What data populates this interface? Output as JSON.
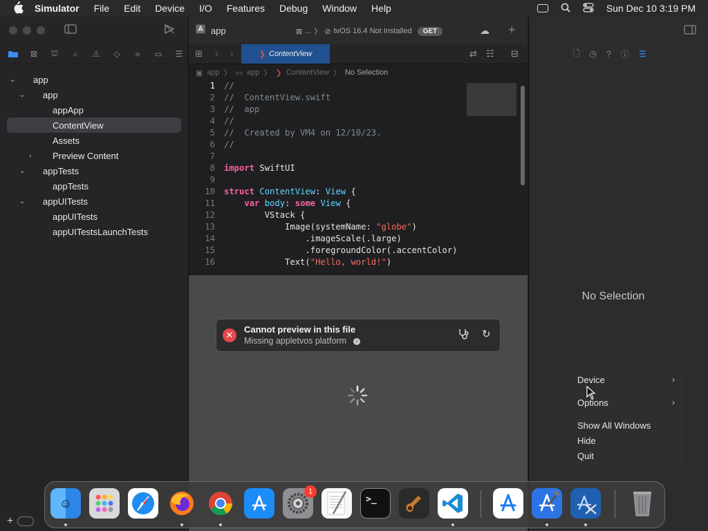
{
  "menubar": {
    "app_name": "Simulator",
    "items": [
      "File",
      "Edit",
      "Device",
      "I/O",
      "Features",
      "Debug",
      "Window",
      "Help"
    ],
    "datetime": "Sun Dec 10  3:19 PM"
  },
  "navigator": {
    "tree": [
      {
        "label": "app",
        "level": 0,
        "expanded": true
      },
      {
        "label": "app",
        "level": 1,
        "expanded": true
      },
      {
        "label": "appApp",
        "level": 2
      },
      {
        "label": "ContentView",
        "level": 2,
        "selected": true
      },
      {
        "label": "Assets",
        "level": 2
      },
      {
        "label": "Preview Content",
        "level": 2,
        "collapsed": true
      },
      {
        "label": "appTests",
        "level": 1,
        "expanded": true
      },
      {
        "label": "appTests",
        "level": 2
      },
      {
        "label": "appUITests",
        "level": 1,
        "expanded": true
      },
      {
        "label": "appUITests",
        "level": 2
      },
      {
        "label": "appUITestsLaunchTests",
        "level": 2
      }
    ]
  },
  "editor": {
    "project_name": "app",
    "scheme_ellipsis": "...",
    "destination": "tvOS 16.4 Not Installed",
    "get_label": "GET",
    "tab_label": "ContentView",
    "breadcrumb": [
      "app",
      "app",
      "ContentView",
      "No Selection"
    ],
    "code_lines": [
      "//",
      "//  ContentView.swift",
      "//  app",
      "//",
      "//  Created by VM4 on 12/10/23.",
      "//",
      "",
      "import SwiftUI",
      "",
      "struct ContentView: View {",
      "    var body: some View {",
      "        VStack {",
      "            Image(systemName: \"globe\")",
      "                .imageScale(.large)",
      "                .foregroundColor(.accentColor)",
      "            Text(\"Hello, world!\")"
    ]
  },
  "preview": {
    "error_title": "Cannot preview in this file",
    "error_subtitle": "Missing appletvos platform"
  },
  "inspector": {
    "no_selection": "No Selection"
  },
  "context_menu": {
    "device": "Device",
    "options": "Options",
    "show_all": "Show All Windows",
    "hide": "Hide",
    "quit": "Quit"
  },
  "dock": {
    "apps": [
      "finder-icon",
      "launchpad-icon",
      "safari-icon",
      "firefox-icon",
      "chrome-icon",
      "app-store-icon",
      "system-settings-icon",
      "textedit-icon",
      "terminal-icon",
      "garageband-icon",
      "vscode-icon",
      "instruments-icon",
      "xcode-icon",
      "simulator-icon",
      "trash-icon"
    ],
    "settings_badge": "1"
  },
  "colors": {
    "accent": "#3b8cf5",
    "keyword": "#fc5fa3",
    "type": "#5dd8ff",
    "string": "#fc6a5d",
    "comment": "#7f8c8d",
    "error": "#e5484d"
  }
}
